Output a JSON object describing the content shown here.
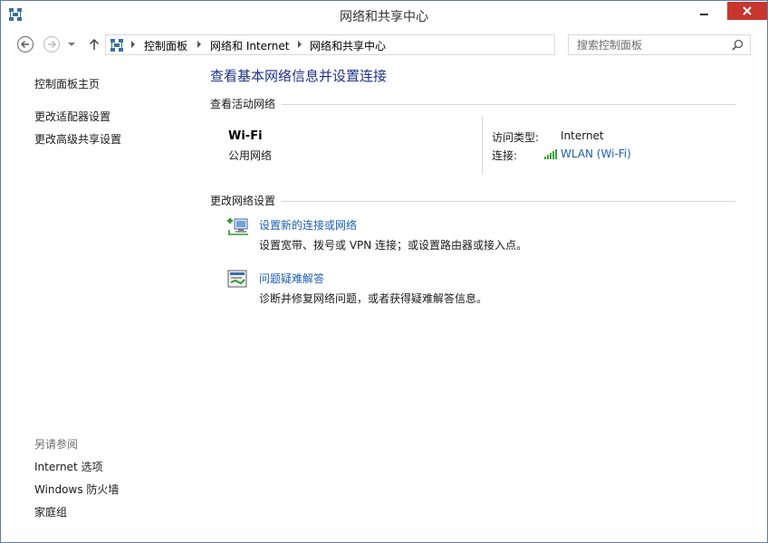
{
  "window": {
    "title": "网络和共享中心",
    "accent": "#1e3287",
    "link_color": "#1e5fb4"
  },
  "titlebar": {
    "icon": "network-center-icon",
    "controls": [
      "minimize-icon",
      "maximize-icon",
      "close-icon"
    ]
  },
  "navigation": {
    "back": "back-arrow-icon",
    "forward": "forward-arrow-icon",
    "recent": "chevron-down-icon",
    "up": "up-arrow-icon",
    "breadcrumb": [
      "控制面板",
      "网络和 Internet",
      "网络和共享中心"
    ],
    "refresh": "refresh-icon"
  },
  "search": {
    "placeholder": "搜索控制面板",
    "value": ""
  },
  "sidebar": {
    "links": [
      "控制面板主页",
      "更改适配器设置",
      "更改高级共享设置"
    ],
    "see_also_title": "另请参阅",
    "see_also_links": [
      "Internet 选项",
      "Windows 防火墙",
      "家庭组"
    ]
  },
  "main": {
    "title": "查看基本网络信息并设置连接",
    "active_networks": {
      "heading": "查看活动网络",
      "network_name": "Wi-Fi",
      "network_category": "公用网络",
      "access_type_label": "访问类型:",
      "access_type_value": "Internet",
      "connections_label": "连接:",
      "connection_name": "WLAN (Wi-Fi)",
      "connection_icon": "wifi-signal-icon",
      "signal_color": "#3aa33a"
    },
    "change_settings": {
      "heading": "更改网络设置",
      "tasks": [
        {
          "icon": "new-connection-icon",
          "title": "设置新的连接或网络",
          "description": "设置宽带、拨号或 VPN 连接；或设置路由器或接入点。"
        },
        {
          "icon": "troubleshoot-icon",
          "title": "问题疑难解答",
          "description": "诊断并修复网络问题，或者获得疑难解答信息。"
        }
      ]
    }
  }
}
